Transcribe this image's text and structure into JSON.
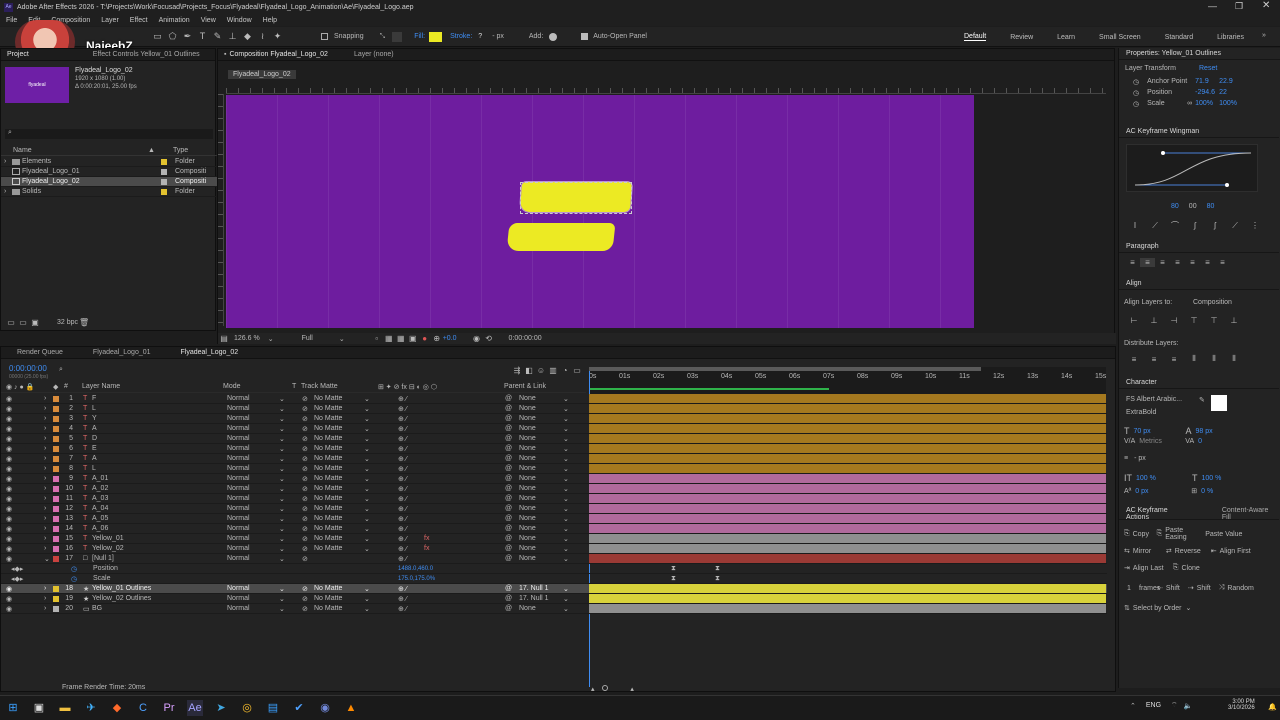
{
  "window": {
    "title": "Adobe After Effects 2026 - T:\\Projects\\Work\\Focusad\\Projects_Focus\\Flyadeal\\Flyadeal_Logo_Animation\\Ae\\Flyadeal_Logo.aep"
  },
  "menu": [
    "File",
    "Edit",
    "Composition",
    "Layer",
    "Effect",
    "Animation",
    "View",
    "Window",
    "Help"
  ],
  "webcam": {
    "name": "NajeebZ"
  },
  "toolbar": {
    "snapping": "Snapping",
    "fill": "Fill:",
    "stroke": "Stroke:",
    "stroke_width": "- px",
    "add": "Add:",
    "auto_open": "Auto-Open Panel"
  },
  "workspaces": [
    "Default",
    "Review",
    "Learn",
    "Small Screen",
    "Standard",
    "Libraries"
  ],
  "project": {
    "tab1": "Project",
    "tab2": "Effect Controls Yellow_01 Outlines",
    "comp_name": "Flyadeal_Logo_02",
    "comp_info1": "1920 x 1080 (1.00)",
    "comp_info2": "Δ 0:00:20:01, 25.00 fps",
    "col_name": "Name",
    "col_type": "Type",
    "items": [
      {
        "name": "Elements",
        "type": "Folder",
        "color": "#e3c22f"
      },
      {
        "name": "Flyadeal_Logo_01",
        "type": "Compositi",
        "color": "#b3b3b3"
      },
      {
        "name": "Flyadeal_Logo_02",
        "type": "Compositi",
        "color": "#b3b3b3"
      },
      {
        "name": "Solids",
        "type": "Folder",
        "color": "#e3c22f"
      }
    ],
    "bpc": "32 bpc"
  },
  "viewer": {
    "tab_comp": "Composition Flyadeal_Logo_02",
    "tab_layer": "Layer (none)",
    "breadcrumb": "Flyadeal_Logo_02",
    "zoom": "126.6 %",
    "resolution": "Full",
    "timecode": "0:00:00:00",
    "exposure": "+0.0"
  },
  "timeline": {
    "tab_queue": "Render Queue",
    "tab1": "Flyadeal_Logo_01",
    "tab2": "Flyadeal_Logo_02",
    "timecode": "0:00:00:00",
    "frame_info": "00000 (25.00 fps)",
    "headers": {
      "layer_name": "Layer Name",
      "mode": "Mode",
      "t": "T",
      "track_matte": "Track Matte",
      "parent": "Parent & Link"
    },
    "ruler": [
      "0s",
      "01s",
      "02s",
      "03s",
      "04s",
      "05s",
      "06s",
      "07s",
      "08s",
      "09s",
      "10s",
      "11s",
      "12s",
      "13s",
      "14s",
      "15s"
    ],
    "layers": [
      {
        "num": "1",
        "name": "F",
        "mode": "Normal",
        "matte": "No Matte",
        "parent": "None",
        "label": "#d88b3b",
        "bar": "#a5791f",
        "fx": false
      },
      {
        "num": "2",
        "name": "L",
        "mode": "Normal",
        "matte": "No Matte",
        "parent": "None",
        "label": "#d88b3b",
        "bar": "#a5791f",
        "fx": false
      },
      {
        "num": "3",
        "name": "Y",
        "mode": "Normal",
        "matte": "No Matte",
        "parent": "None",
        "label": "#d88b3b",
        "bar": "#a5791f",
        "fx": false
      },
      {
        "num": "4",
        "name": "A",
        "mode": "Normal",
        "matte": "No Matte",
        "parent": "None",
        "label": "#d88b3b",
        "bar": "#a5791f",
        "fx": false
      },
      {
        "num": "5",
        "name": "D",
        "mode": "Normal",
        "matte": "No Matte",
        "parent": "None",
        "label": "#d88b3b",
        "bar": "#a5791f",
        "fx": false
      },
      {
        "num": "6",
        "name": "E",
        "mode": "Normal",
        "matte": "No Matte",
        "parent": "None",
        "label": "#d88b3b",
        "bar": "#a5791f",
        "fx": false
      },
      {
        "num": "7",
        "name": "A",
        "mode": "Normal",
        "matte": "No Matte",
        "parent": "None",
        "label": "#d88b3b",
        "bar": "#a5791f",
        "fx": false
      },
      {
        "num": "8",
        "name": "L",
        "mode": "Normal",
        "matte": "No Matte",
        "parent": "None",
        "label": "#d88b3b",
        "bar": "#a5791f",
        "fx": false
      },
      {
        "num": "9",
        "name": "A_01",
        "mode": "Normal",
        "matte": "No Matte",
        "parent": "None",
        "label": "#d86fb1",
        "bar": "#b06a9c",
        "fx": false
      },
      {
        "num": "10",
        "name": "A_02",
        "mode": "Normal",
        "matte": "No Matte",
        "parent": "None",
        "label": "#d86fb1",
        "bar": "#b06a9c",
        "fx": false
      },
      {
        "num": "11",
        "name": "A_03",
        "mode": "Normal",
        "matte": "No Matte",
        "parent": "None",
        "label": "#d86fb1",
        "bar": "#b06a9c",
        "fx": false
      },
      {
        "num": "12",
        "name": "A_04",
        "mode": "Normal",
        "matte": "No Matte",
        "parent": "None",
        "label": "#d86fb1",
        "bar": "#b06a9c",
        "fx": false
      },
      {
        "num": "13",
        "name": "A_05",
        "mode": "Normal",
        "matte": "No Matte",
        "parent": "None",
        "label": "#d86fb1",
        "bar": "#b06a9c",
        "fx": false
      },
      {
        "num": "14",
        "name": "A_06",
        "mode": "Normal",
        "matte": "No Matte",
        "parent": "None",
        "label": "#d86fb1",
        "bar": "#b06a9c",
        "fx": false
      },
      {
        "num": "15",
        "name": "Yellow_01",
        "mode": "Normal",
        "matte": "No Matte",
        "parent": "None",
        "label": "#d86fb1",
        "bar": "#8f8f8f",
        "fx": true
      },
      {
        "num": "16",
        "name": "Yellow_02",
        "mode": "Normal",
        "matte": "No Matte",
        "parent": "None",
        "label": "#d86fb1",
        "bar": "#8f8f8f",
        "fx": true
      },
      {
        "num": "17",
        "name": "[Null 1]",
        "mode": "Normal",
        "matte": "",
        "parent": "None",
        "label": "#c9423f",
        "bar": "#9a3a35",
        "fx": false
      }
    ],
    "props": [
      {
        "name": "Position",
        "value": "1488.0,460.0"
      },
      {
        "name": "Scale",
        "value": "175.0,175.0%"
      }
    ],
    "layers2": [
      {
        "num": "18",
        "name": "Yellow_01 Outlines",
        "mode": "Normal",
        "matte": "No Matte",
        "parent": "17. Null 1",
        "label": "#e3c22f",
        "bar": "#d8d23b",
        "selected": true
      },
      {
        "num": "19",
        "name": "Yellow_02 Outlines",
        "mode": "Normal",
        "matte": "No Matte",
        "parent": "17. Null 1",
        "label": "#e3c22f",
        "bar": "#d8d23b",
        "selected": false
      },
      {
        "num": "20",
        "name": "BG",
        "mode": "Normal",
        "matte": "No Matte",
        "parent": "None",
        "label": "#b3b3b3",
        "bar": "#8f8f8f",
        "selected": false
      }
    ],
    "render_time": "Frame Render Time: 20ms"
  },
  "properties": {
    "title": "Properties: Yellow_01 Outlines",
    "transform": "Layer Transform",
    "reset": "Reset",
    "rows": [
      {
        "label": "Anchor Point",
        "v1": "71.9",
        "v2": "22.9"
      },
      {
        "label": "Position",
        "v1": "-294.6",
        "v2": "22"
      },
      {
        "label": "Scale",
        "v1": "100%",
        "v2": "100%"
      }
    ]
  },
  "wingman": {
    "title": "AC Keyframe Wingman",
    "v1": "80",
    "v2": "00",
    "v3": "80"
  },
  "paragraph": {
    "title": "Paragraph"
  },
  "align": {
    "title": "Align",
    "align_to": "Align Layers to:",
    "target": "Composition",
    "distribute": "Distribute Layers:"
  },
  "character": {
    "title": "Character",
    "font": "FS Albert Arabic...",
    "style": "ExtraBold",
    "size": "70 px",
    "leading": "98 px",
    "metrics": "Metrics",
    "tracking": "0",
    "unit": "- px",
    "vscale": "100 %",
    "hscale": "100 %",
    "baseline": "0 px",
    "tsume": "0 %"
  },
  "actions": {
    "title": "AC Keyframe Actions",
    "tab2": "Content-Aware Fill",
    "copy": "Copy",
    "paste_easing": "Paste Easing",
    "paste_value": "Paste Value",
    "mirror": "Mirror",
    "reverse": "Reverse",
    "align_first": "Align First",
    "align_last": "Align Last",
    "clone": "Clone",
    "frames_num": "1",
    "frames": "frames",
    "shift": "Shift",
    "shift2": "Shift",
    "random": "Random",
    "select_by_order": "Select by Order"
  },
  "clock": {
    "time": "3:00 PM",
    "date": "3/10/2026",
    "lang": "ENG"
  }
}
